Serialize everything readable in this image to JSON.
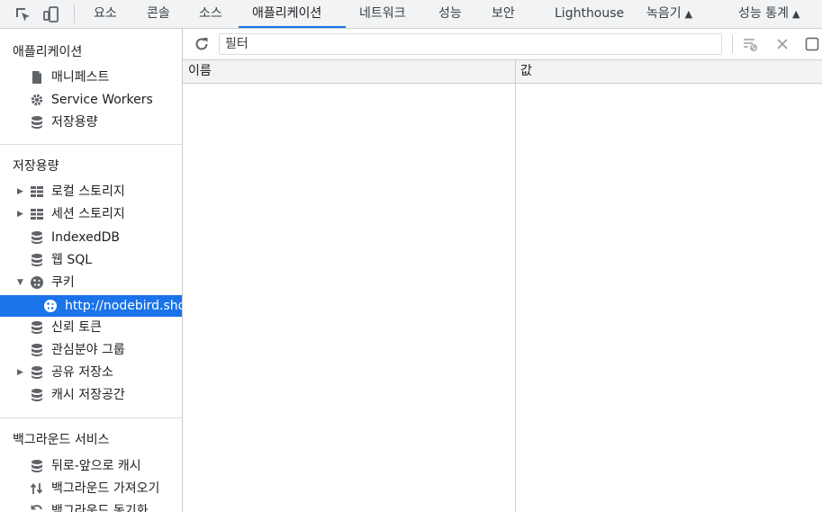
{
  "top_tabs": [
    {
      "label": "요소"
    },
    {
      "label": "콘솔"
    },
    {
      "label": "소스"
    },
    {
      "label": "애플리케이션",
      "active": true
    },
    {
      "label": "네트워크"
    },
    {
      "label": "성능"
    },
    {
      "label": "보안"
    },
    {
      "label": "Lighthouse"
    },
    {
      "label": "녹음기"
    },
    {
      "label": "성능 통계"
    }
  ],
  "icons": {
    "flask": "▲",
    "arrow_right": "▶",
    "arrow_down": "▼"
  },
  "sidebar": {
    "app_title": "애플리케이션",
    "app_items": [
      {
        "label": "매니페스트",
        "icon": "document-icon"
      },
      {
        "label": "Service Workers",
        "icon": "gear-icon"
      },
      {
        "label": "저장용량",
        "icon": "database-icon"
      }
    ],
    "storage_title": "저장용량",
    "storage_items": [
      {
        "label": "로컬 스토리지",
        "icon": "grid-icon",
        "expandable": true
      },
      {
        "label": "세션 스토리지",
        "icon": "grid-icon",
        "expandable": true
      },
      {
        "label": "IndexedDB",
        "icon": "database-icon"
      },
      {
        "label": "웹 SQL",
        "icon": "database-icon"
      },
      {
        "label": "쿠키",
        "icon": "cookie-icon",
        "expanded": true
      },
      {
        "label": "http://nodebird.shop",
        "icon": "cookie-icon",
        "selected": true
      },
      {
        "label": "신뢰 토큰",
        "icon": "database-icon"
      },
      {
        "label": "관심분야 그룹",
        "icon": "database-icon"
      },
      {
        "label": "공유 저장소",
        "icon": "database-icon",
        "expandable": true
      },
      {
        "label": "캐시 저장공간",
        "icon": "database-icon"
      }
    ],
    "bg_title": "백그라운드 서비스",
    "bg_items": [
      {
        "label": "뒤로-앞으로 캐시",
        "icon": "database-icon"
      },
      {
        "label": "백그라운드 가져오기",
        "icon": "arrows-updown-icon"
      },
      {
        "label": "백그라운드 동기화",
        "icon": "sync-icon"
      }
    ]
  },
  "toolbar": {
    "filter_placeholder": "필터",
    "filter_value": ""
  },
  "table": {
    "columns": [
      "이름",
      "값"
    ]
  },
  "colors": {
    "accent": "#1a73e8",
    "toolbar_bg": "#f1f3f4",
    "border": "#cbcdd1"
  }
}
